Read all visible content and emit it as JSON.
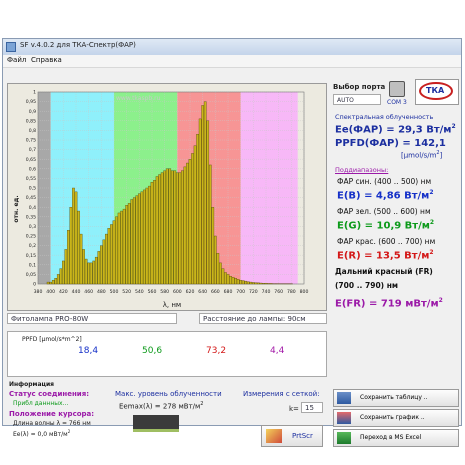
{
  "window": {
    "title": "SF v.4.0.2 для ТКА-Спектр(ФАР)",
    "menu": [
      "Файл",
      "Справка"
    ]
  },
  "chart_data": {
    "type": "bar",
    "title": "",
    "xlabel": "λ, нм",
    "ylabel": "отн. ед.",
    "xlim": [
      380,
      800
    ],
    "ylim": [
      0,
      1
    ],
    "x_ticks": [
      "380",
      "400",
      "420",
      "440",
      "460",
      "480",
      "500",
      "520",
      "540",
      "560",
      "580",
      "600",
      "620",
      "640",
      "660",
      "680",
      "700",
      "720",
      "740",
      "760",
      "780",
      "800"
    ],
    "y_ticks": [
      "0",
      "0,05",
      "0,1",
      "0,15",
      "0,2",
      "0,25",
      "0,3",
      "0,35",
      "0,4",
      "0,45",
      "0,5",
      "0,55",
      "0,6",
      "0,65",
      "0,7",
      "0,75",
      "0,8",
      "0,85",
      "0,9",
      "0,95",
      "1"
    ],
    "watermark": "www.tkaspb.ru",
    "bands": [
      {
        "from": 380,
        "to": 400,
        "color": "#a8a8a8"
      },
      {
        "from": 400,
        "to": 500,
        "color": "#8ff0fb"
      },
      {
        "from": 500,
        "to": 600,
        "color": "#8cf08c"
      },
      {
        "from": 600,
        "to": 700,
        "color": "#f79595"
      },
      {
        "from": 700,
        "to": 790,
        "color": "#f7b8f7"
      }
    ],
    "x": [
      384,
      388,
      392,
      396,
      400,
      404,
      408,
      412,
      416,
      420,
      424,
      428,
      432,
      436,
      440,
      444,
      448,
      452,
      456,
      460,
      464,
      468,
      472,
      476,
      480,
      484,
      488,
      492,
      496,
      500,
      504,
      508,
      512,
      516,
      520,
      524,
      528,
      532,
      536,
      540,
      544,
      548,
      552,
      556,
      560,
      564,
      568,
      572,
      576,
      580,
      584,
      588,
      592,
      596,
      600,
      604,
      608,
      612,
      616,
      620,
      624,
      628,
      632,
      636,
      640,
      644,
      648,
      652,
      656,
      660,
      664,
      668,
      672,
      676,
      680,
      684,
      688,
      692,
      696,
      700,
      704,
      708,
      712,
      716,
      720,
      724,
      728,
      732,
      736,
      740,
      744,
      748,
      752,
      756,
      760,
      764,
      768,
      772,
      776,
      780,
      784,
      788
    ],
    "values": [
      0,
      0,
      0,
      0.01,
      0.01,
      0.02,
      0.03,
      0.05,
      0.08,
      0.12,
      0.18,
      0.28,
      0.4,
      0.5,
      0.48,
      0.38,
      0.26,
      0.18,
      0.13,
      0.11,
      0.11,
      0.12,
      0.14,
      0.17,
      0.2,
      0.23,
      0.26,
      0.29,
      0.31,
      0.33,
      0.35,
      0.37,
      0.38,
      0.39,
      0.41,
      0.42,
      0.44,
      0.45,
      0.46,
      0.47,
      0.48,
      0.49,
      0.5,
      0.51,
      0.53,
      0.54,
      0.56,
      0.57,
      0.58,
      0.59,
      0.6,
      0.6,
      0.59,
      0.59,
      0.58,
      0.58,
      0.59,
      0.61,
      0.63,
      0.65,
      0.68,
      0.72,
      0.78,
      0.86,
      0.93,
      0.95,
      0.85,
      0.62,
      0.4,
      0.25,
      0.16,
      0.11,
      0.08,
      0.06,
      0.05,
      0.04,
      0.035,
      0.03,
      0.025,
      0.02,
      0.018,
      0.015,
      0.012,
      0.01,
      0.008,
      0.007,
      0.006,
      0.005,
      0.004,
      0.004,
      0.003,
      0.003,
      0.002,
      0.002,
      0.002,
      0.001,
      0.001,
      0.001,
      0.001,
      0.001,
      0,
      0
    ]
  },
  "lamp_field": "Фитолампа PRO-80W",
  "distance_field": "Расстояние до лампы: 90см",
  "ppfd": {
    "caption": "PPFD [μmol/s*m^2]",
    "values": [
      {
        "value": "18,4",
        "color": "#1530c8"
      },
      {
        "value": "50,6",
        "color": "#0c9a1a"
      },
      {
        "value": "73,2",
        "color": "#d31818"
      },
      {
        "value": "4,4",
        "color": "#a31aa8"
      }
    ]
  },
  "right_panel": {
    "port_label": "Выбор порта",
    "port_value": "AUTO",
    "com_label": "COM 3",
    "logo_text": "ТКА",
    "spectral_title": "Спектральная облученность",
    "ee_par": "Ee(ФАР) = 29,3 Вт/м",
    "ee_sup": "2",
    "ppfd_par": "PPFD(ФАР) = 142,1",
    "ppfd_unit": "[μmol/s/m",
    "ppfd_unit_sup": "2",
    "ppfd_unit_end": "]",
    "subranges_title": "Поддиапазоны:",
    "blue_range": "ФАР син. (400 .. 500) нм",
    "blue_value": "E(B) = 4,86 Вт/м",
    "green_range": "ФАР зел. (500 .. 600) нм",
    "green_value": "E(G) = 10,9 Вт/м",
    "red_range": "ФАР крас. (600 .. 700) нм",
    "red_value": "E(R) = 13,5 Вт/м",
    "fr_range": "Дальний красный (FR)",
    "fr_range2": "(700 .. 790) нм",
    "fr_value": "E(FR) = 719 мВт/м",
    "sup": "2",
    "colors": {
      "blue": "#1530c8",
      "green": "#0c9a1a",
      "red": "#d31818",
      "purple": "#9b1aa8",
      "title": "#1c2fa0"
    }
  },
  "bottom": {
    "info_label": "Информация",
    "status_label": "Статус соединения:",
    "status_value": "Прибл даннных...",
    "cursor_label": "Положение курсора:",
    "wavelength_text": "Длина волны λ = 766 нм",
    "ee_text": "Ee(λ) = 0,0 мВт/м",
    "max_label": "Макс. уровень облученности",
    "max_value": "Eemax(λ) = 278 мВт/м",
    "grid_label": "Измерения с сеткой:",
    "k_label": "k=",
    "k_value": "15",
    "prtscr_label": "PrtScr",
    "save_table": "Сохранить таблицу ..",
    "save_chart": "Сохранить график ..",
    "ms_excel": "Переход в MS Excel"
  }
}
